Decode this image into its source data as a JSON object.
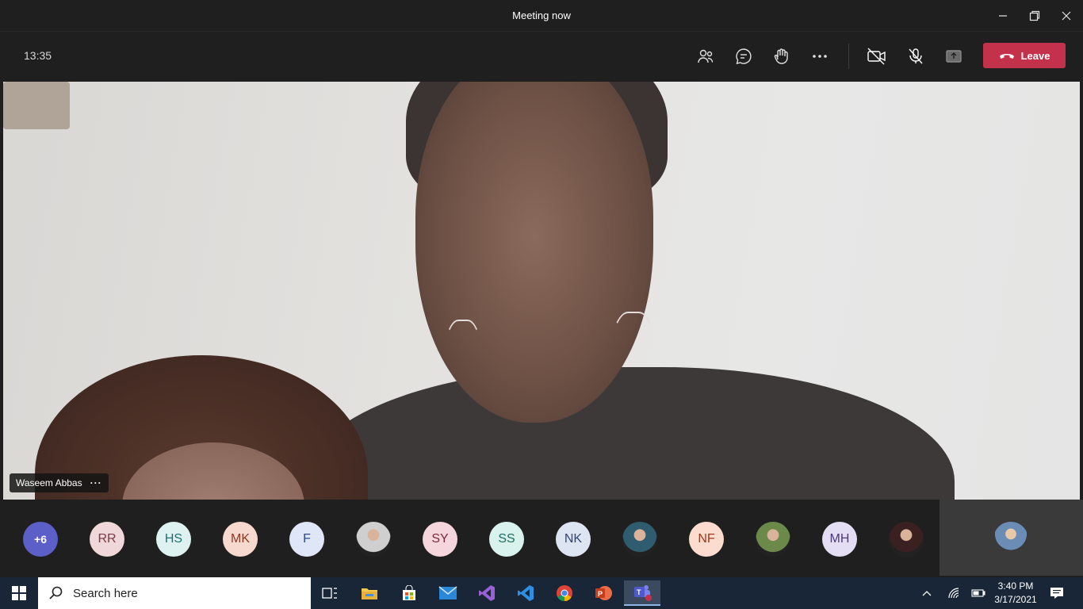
{
  "window": {
    "title": "Meeting now"
  },
  "toolbar": {
    "elapsed": "13:35",
    "leave_label": "Leave"
  },
  "video": {
    "participant_name": "Waseem Abbas"
  },
  "participants": [
    {
      "initials": "+6",
      "bg": "#5b5fc7",
      "fg": "#ffffff",
      "photo": false
    },
    {
      "initials": "RR",
      "bg": "#f0d7d9",
      "fg": "#7a3a40",
      "photo": false
    },
    {
      "initials": "HS",
      "bg": "#dff2f2",
      "fg": "#1f6e72",
      "photo": false
    },
    {
      "initials": "MK",
      "bg": "#f7d9cf",
      "fg": "#8a3a25",
      "photo": false
    },
    {
      "initials": "F",
      "bg": "#dfe6f7",
      "fg": "#2c4a8a",
      "photo": false
    },
    {
      "initials": "",
      "bg": "#cfcfcf",
      "fg": "#333333",
      "photo": true
    },
    {
      "initials": "SY",
      "bg": "#f5d6dc",
      "fg": "#7a2a3a",
      "photo": false
    },
    {
      "initials": "SS",
      "bg": "#d9f2ee",
      "fg": "#1e6b5f",
      "photo": false
    },
    {
      "initials": "NK",
      "bg": "#dde5f3",
      "fg": "#2f4670",
      "photo": false
    },
    {
      "initials": "",
      "bg": "#2f5c6e",
      "fg": "#ffffff",
      "photo": true
    },
    {
      "initials": "NF",
      "bg": "#fbdccf",
      "fg": "#9a3a1a",
      "photo": false
    },
    {
      "initials": "",
      "bg": "#6b8a4a",
      "fg": "#ffffff",
      "photo": true
    },
    {
      "initials": "MH",
      "bg": "#e3def3",
      "fg": "#4a3a80",
      "photo": false
    },
    {
      "initials": "",
      "bg": "#3a2020",
      "fg": "#ffffff",
      "photo": true
    }
  ],
  "taskbar": {
    "search_placeholder": "Search here",
    "time": "3:40 PM",
    "date": "3/17/2021"
  },
  "colors": {
    "leave": "#c4314b",
    "taskbar": "#182638",
    "accent": "#5b5fc7"
  }
}
